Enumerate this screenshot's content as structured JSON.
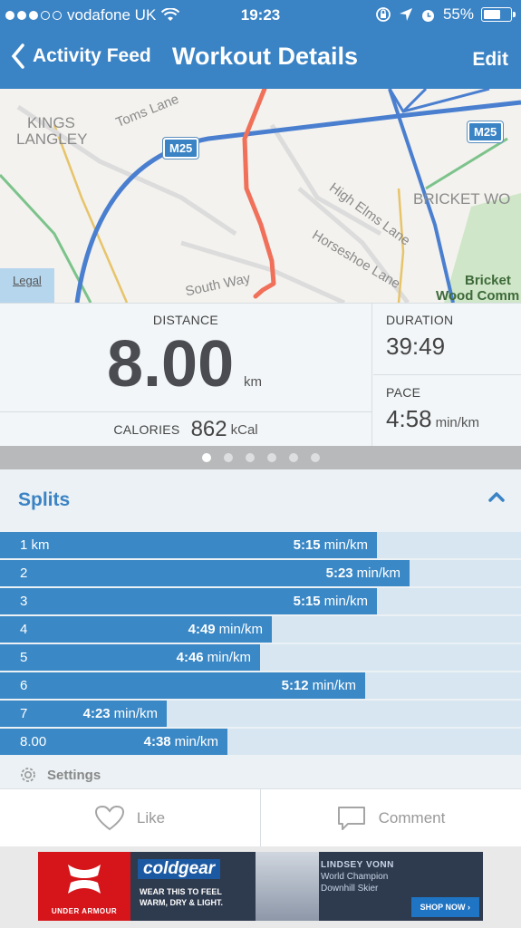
{
  "status_bar": {
    "carrier": "vodafone UK",
    "time": "19:23",
    "battery": "55%"
  },
  "nav": {
    "back_label": "Activity Feed",
    "title": "Workout Details",
    "edit_label": "Edit"
  },
  "map": {
    "labels": {
      "kings": "KINGS",
      "langley": "LANGLEY",
      "toms_lane": "Toms Lane",
      "high_elms_lane": "High Elms Lane",
      "horseshoe_lane": "Horseshoe Lane",
      "south_way": "South Way",
      "bricket_wo": "BRICKET WO",
      "bricket": "Bricket",
      "wood_comm": "Wood Comm"
    },
    "motorway_left": "M25",
    "motorway_right": "M25",
    "legal": "Legal",
    "route_color": "#f0705a"
  },
  "stats": {
    "distance_label": "DISTANCE",
    "distance_value": "8.00",
    "distance_unit": "km",
    "calories_label": "CALORIES",
    "calories_value": "862",
    "calories_unit": "kCal",
    "duration_label": "DURATION",
    "duration_value": "39:49",
    "pace_label": "PACE",
    "pace_value": "4:58",
    "pace_unit": "min/km"
  },
  "pager": {
    "count": 6,
    "active_index": 0
  },
  "splits": {
    "title": "Splits",
    "pace_unit": "min/km",
    "rows": [
      {
        "km": "1 km",
        "pace": "5:15",
        "seconds": 315
      },
      {
        "km": "2",
        "pace": "5:23",
        "seconds": 323
      },
      {
        "km": "3",
        "pace": "5:15",
        "seconds": 315
      },
      {
        "km": "4",
        "pace": "4:49",
        "seconds": 289
      },
      {
        "km": "5",
        "pace": "4:46",
        "seconds": 286
      },
      {
        "km": "6",
        "pace": "5:12",
        "seconds": 312
      },
      {
        "km": "7",
        "pace": "4:23",
        "seconds": 263
      },
      {
        "km": "8.00",
        "pace": "4:38",
        "seconds": 278
      }
    ],
    "settings_label": "Settings"
  },
  "actions": {
    "like_label": "Like",
    "comment_label": "Comment"
  },
  "ad": {
    "brand_logo": "UNDER ARMOUR",
    "product": "coldgear",
    "tagline_1": "WEAR THIS TO FEEL",
    "tagline_2": "WARM, DRY & LIGHT.",
    "athlete": "LINDSEY VONN",
    "athlete_line_1": "World Champion",
    "athlete_line_2": "Downhill Skier",
    "cta": "SHOP NOW ›"
  },
  "colors": {
    "accent": "#3a83c5",
    "split_bar": "#3a88c6",
    "split_track": "#d7e6f0"
  }
}
